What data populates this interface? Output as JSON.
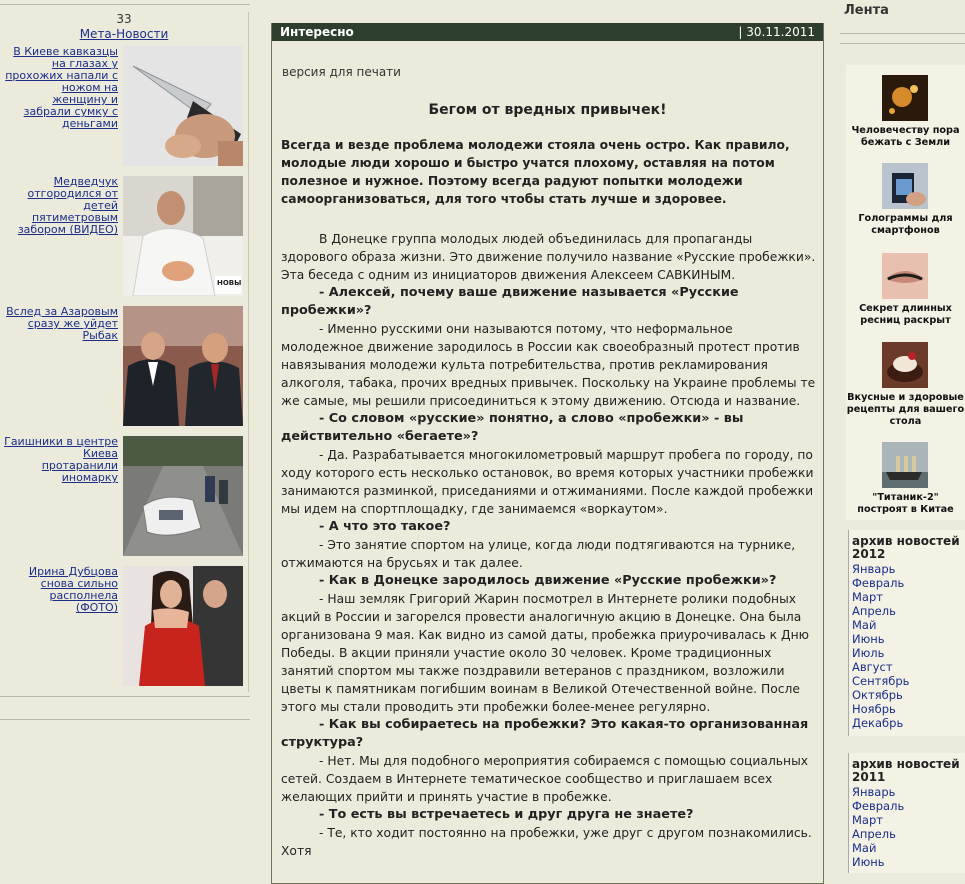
{
  "left": {
    "count": "33",
    "meta_link": "Мета-Новости",
    "news": [
      {
        "text": "В Киеве кавказцы на глазах у прохожих напали с ножом на женщину и забрали сумку с деньгами"
      },
      {
        "text": "Медведчук отгородился от детей пятиметровым забором (ВИДЕО)",
        "watermark": "НОВЫ РЕГИО"
      },
      {
        "text": "Вслед за Азаровым сразу же уйдет Рыбак"
      },
      {
        "text": "Гаишники в центре Киева протаранили иномарку"
      },
      {
        "text": "Ирина Дубцова снова сильно располнела (ФОТО)"
      }
    ]
  },
  "center": {
    "section": "Интересно",
    "date": "| 30.11.2011",
    "print_link": "версия для печати",
    "title": "Бегом от вредных привычек!",
    "lead": "Всегда и везде проблема молодежи стояла очень остро. Как правило, молодые люди хорошо и быстро учатся плохому, оставляя на потом полезное и нужное. Поэтому всегда радуют попытки молодежи самоорганизоваться, для того чтобы стать лучше и здоровее.",
    "paragraphs": [
      {
        "q": false,
        "text": "В Донецке группа молодых людей объединилась для пропаганды здорового образа жизни. Это движение получило название «Русские пробежки». Эта беседа с одним из инициаторов движения Алексеем САВКИНЫМ."
      },
      {
        "q": true,
        "text": "- Алексей, почему ваше движение называется «Русские пробежки»?"
      },
      {
        "q": false,
        "text": "- Именно русскими они называются потому, что неформальное молодежное движение зародилось в России как своеобразный протест против навязывания молодежи культа потребительства, против рекламирования алкоголя, табака, прочих вредных привычек. Поскольку на Украине проблемы те же самые, мы решили присоединиться к этому движению. Отсюда и название."
      },
      {
        "q": true,
        "text": "- Со словом «русские» понятно, а слово «пробежки» - вы действительно «бегаете»?"
      },
      {
        "q": false,
        "text": "- Да. Разрабатывается многокилометровый маршрут пробега по городу, по ходу которого есть несколько остановок, во время которых участники пробежки занимаются разминкой, приседаниями и отжиманиями. После каждой пробежки мы идем на спортплощадку, где занимаемся «воркаутом»."
      },
      {
        "q": true,
        "text": "- А что это такое?"
      },
      {
        "q": false,
        "text": "- Это занятие спортом на улице, когда люди подтягиваются на турнике, отжимаются на брусьях и так далее."
      },
      {
        "q": true,
        "text": "- Как в Донецке зародилось движение «Русские пробежки»?"
      },
      {
        "q": false,
        "text": "- Наш земляк Григорий Жарин посмотрел в Интернете ролики подобных акций в России и загорелся провести аналогичную акцию в Донецке. Она была организована 9 мая. Как видно из самой даты, пробежка приурочивалась к Дню Победы. В акции приняли участие около 30 человек. Кроме традиционных занятий спортом мы также поздравили ветеранов с праздником, возложили цветы к памятникам погибшим воинам в Великой Отечественной войне. После этого мы стали проводить эти пробежки более-менее регулярно."
      },
      {
        "q": true,
        "text": "- Как вы собираетесь на пробежки? Это какая-то организованная структура?"
      },
      {
        "q": false,
        "text": "- Нет. Мы для подобного мероприятия собираемся с помощью социальных сетей. Создаем в Интернете тематическое сообщество и приглашаем всех желающих прийти и принять участие в пробежке."
      },
      {
        "q": true,
        "text": "- То есть вы встречаетесь и друг друга не знаете?"
      },
      {
        "q": false,
        "text": "- Те, кто ходит постоянно на пробежки, уже друг с другом познакомились. Хотя"
      }
    ]
  },
  "right": {
    "lenta": "Лента",
    "feed": [
      {
        "caption": "Человечеству пора бежать с Земли"
      },
      {
        "caption": "Голограммы для смартфонов"
      },
      {
        "caption": "Секрет длинных ресниц раскрыт"
      },
      {
        "caption": "Вкусные и здоровые рецепты для вашего стола"
      },
      {
        "caption": "\"Титаник-2\" построят в Китае"
      }
    ],
    "archive_2012": {
      "heading": "архив новостей 2012",
      "months": [
        "Январь",
        "Февраль",
        "Март",
        "Апрель",
        "Май",
        "Июнь",
        "Июль",
        "Август",
        "Сентябрь",
        "Октябрь",
        "Ноябрь",
        "Декабрь"
      ]
    },
    "archive_2011": {
      "heading": "архив новостей 2011",
      "months": [
        "Январь",
        "Февраль",
        "Март",
        "Апрель",
        "Май",
        "Июнь"
      ]
    }
  }
}
